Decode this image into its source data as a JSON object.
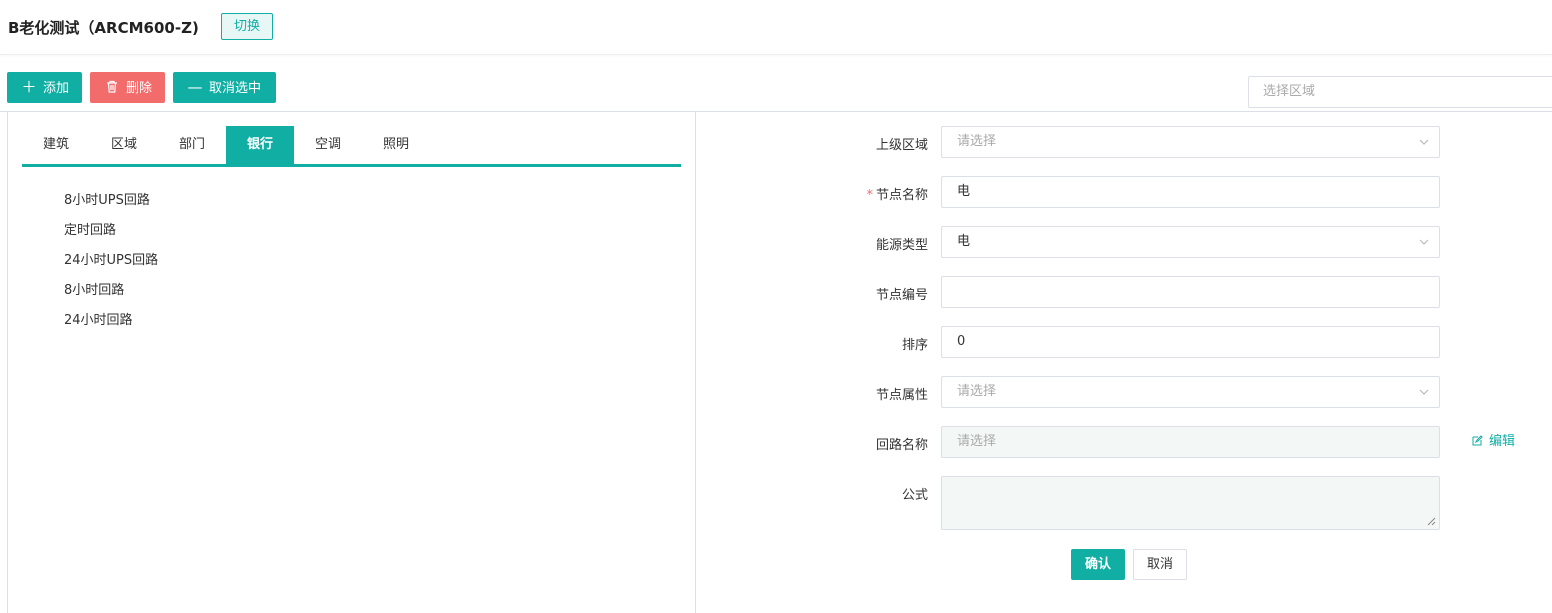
{
  "header": {
    "title": "B老化测试（ARCM600-Z)",
    "switch_label": "切换"
  },
  "toolbar": {
    "add_label": "添加",
    "delete_label": "删除",
    "cancel_select_label": "取消选中",
    "region_placeholder": "选择区域"
  },
  "tabs": [
    {
      "label": "建筑",
      "active": false
    },
    {
      "label": "区域",
      "active": false
    },
    {
      "label": "部门",
      "active": false
    },
    {
      "label": "银行",
      "active": true
    },
    {
      "label": "空调",
      "active": false
    },
    {
      "label": "照明",
      "active": false
    }
  ],
  "tree": {
    "items": [
      "8小时UPS回路",
      "定时回路",
      "24小时UPS回路",
      "8小时回路",
      "24小时回路"
    ]
  },
  "form": {
    "parent_region": {
      "label": "上级区域",
      "placeholder": "请选择"
    },
    "node_name": {
      "label": "节点名称",
      "required_mark": "*",
      "value": "电"
    },
    "energy_type": {
      "label": "能源类型",
      "value": "电"
    },
    "node_code": {
      "label": "节点编号",
      "value": ""
    },
    "sort": {
      "label": "排序",
      "value": "0"
    },
    "node_attr": {
      "label": "节点属性",
      "placeholder": "请选择"
    },
    "circuit_name": {
      "label": "回路名称",
      "placeholder": "请选择",
      "edit_label": "编辑"
    },
    "formula": {
      "label": "公式",
      "value": ""
    },
    "confirm_label": "确认",
    "cancel_label": "取消"
  },
  "colors": {
    "accent": "#11aea4",
    "danger": "#f26c6c",
    "border": "#dcdfe6"
  }
}
